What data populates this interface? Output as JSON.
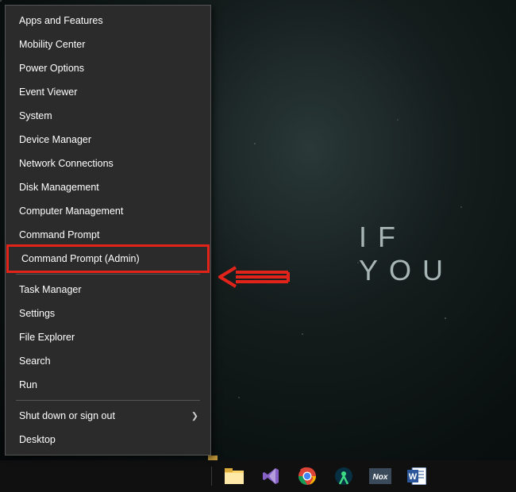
{
  "wallpaper": {
    "text": "IF  YOU"
  },
  "menu": {
    "section1": [
      "Apps and Features",
      "Mobility Center",
      "Power Options",
      "Event Viewer",
      "System",
      "Device Manager",
      "Network Connections",
      "Disk Management",
      "Computer Management",
      "Command Prompt",
      "Command Prompt (Admin)"
    ],
    "section2": [
      "Task Manager",
      "Settings",
      "File Explorer",
      "Search",
      "Run"
    ],
    "section3": [
      "Shut down or sign out",
      "Desktop"
    ]
  },
  "taskbar": {
    "icons": [
      "file-explorer",
      "visual-studio",
      "chrome",
      "android-studio",
      "nox",
      "word"
    ]
  }
}
